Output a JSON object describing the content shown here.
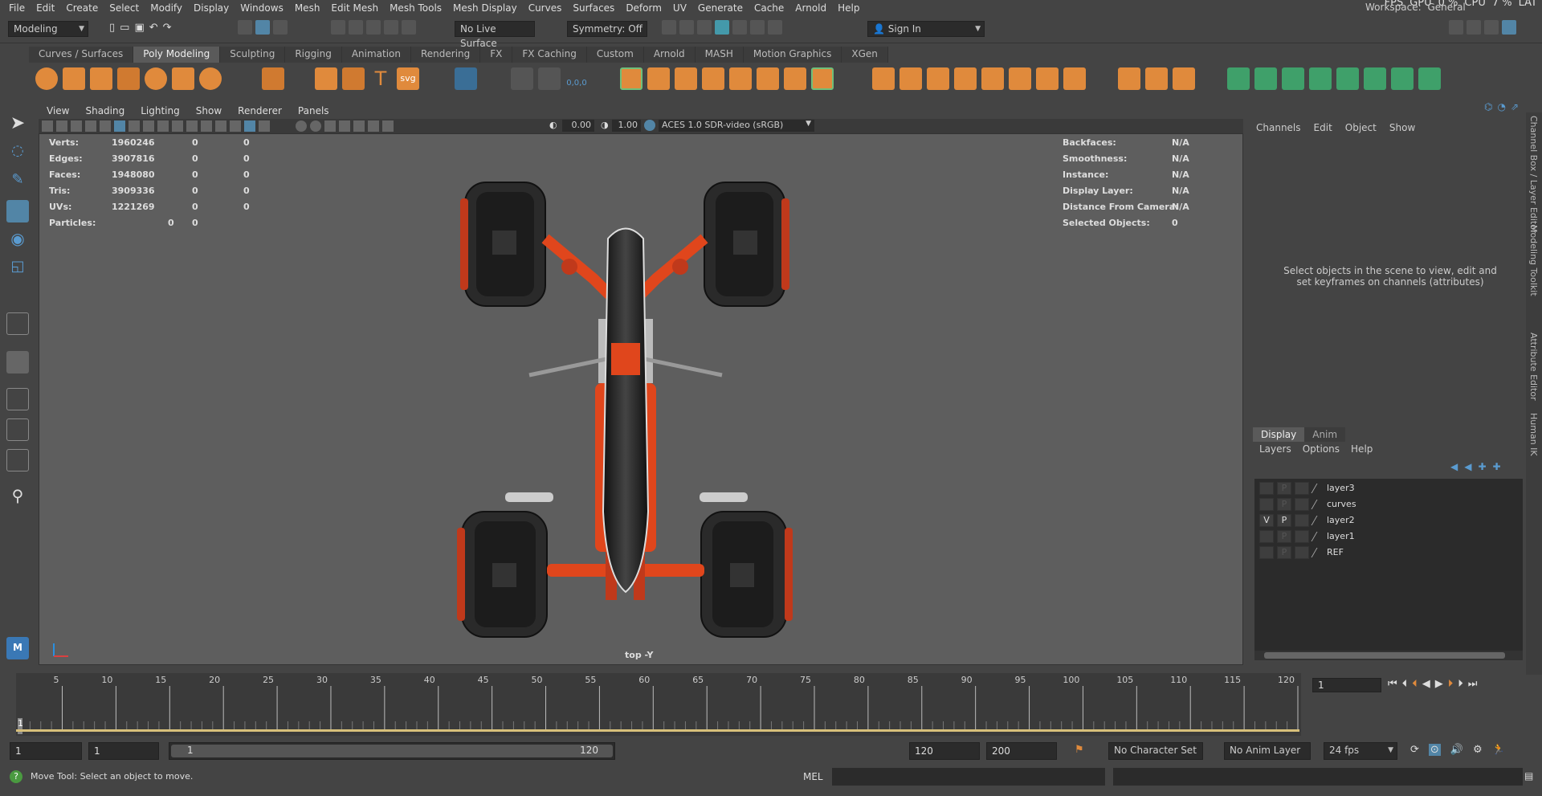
{
  "menu": [
    "File",
    "Edit",
    "Create",
    "Select",
    "Modify",
    "Display",
    "Windows",
    "Mesh",
    "Edit Mesh",
    "Mesh Tools",
    "Mesh Display",
    "Curves",
    "Surfaces",
    "Deform",
    "UV",
    "Generate",
    "Cache",
    "Arnold",
    "Help"
  ],
  "topright": {
    "fps": "FPS",
    "gpu": "GPU",
    "gpu_val": "0 %",
    "cpu": "CPU",
    "cpu_val": "7 %",
    "lat": "LAT",
    "workspace_label": "Workspace:",
    "workspace_value": "General"
  },
  "status": {
    "mode": "Modeling",
    "live_surface": "No Live Surface",
    "symmetry": "Symmetry: Off",
    "sign_in": "Sign In"
  },
  "shelf_tabs": [
    "Curves / Surfaces",
    "Poly Modeling",
    "Sculpting",
    "Rigging",
    "Animation",
    "Rendering",
    "FX",
    "FX Caching",
    "Custom",
    "Arnold",
    "MASH",
    "Motion Graphics",
    "XGen"
  ],
  "shelf_active": "Poly Modeling",
  "shelf_text_icon": "T",
  "shelf_svg_icon": "svg",
  "shelf_number_icon": "0,0,0",
  "viewport": {
    "menu": [
      "View",
      "Shading",
      "Lighting",
      "Show",
      "Renderer",
      "Panels"
    ],
    "exposure": "0.00",
    "gamma": "1.00",
    "color_space": "ACES 1.0 SDR-video (sRGB)",
    "camera_label": "top -Y",
    "hud_left": [
      {
        "label": "Verts:",
        "v1": "1960246",
        "v2": "0",
        "v3": "0"
      },
      {
        "label": "Edges:",
        "v1": "3907816",
        "v2": "0",
        "v3": "0"
      },
      {
        "label": "Faces:",
        "v1": "1948080",
        "v2": "0",
        "v3": "0"
      },
      {
        "label": "Tris:",
        "v1": "3909336",
        "v2": "0",
        "v3": "0"
      },
      {
        "label": "UVs:",
        "v1": "1221269",
        "v2": "0",
        "v3": "0"
      }
    ],
    "particles": {
      "label": "Particles:",
      "v1": "0",
      "v2": "0"
    },
    "hud_right": [
      {
        "label": "Backfaces:",
        "value": "N/A"
      },
      {
        "label": "Smoothness:",
        "value": "N/A"
      },
      {
        "label": "Instance:",
        "value": "N/A"
      },
      {
        "label": "Display Layer:",
        "value": "N/A"
      },
      {
        "label": "Distance From Camera:",
        "value": "N/A"
      },
      {
        "label": "Selected Objects:",
        "value": "0"
      }
    ]
  },
  "channel_box": {
    "menu": [
      "Channels",
      "Edit",
      "Object",
      "Show"
    ],
    "message": "Select objects in the scene to view, edit and set keyframes on channels (attributes)"
  },
  "layer_editor": {
    "tabs": [
      "Display",
      "Anim"
    ],
    "menu": [
      "Layers",
      "Options",
      "Help"
    ],
    "layers": [
      {
        "name": "layer3",
        "v": "",
        "p": "P"
      },
      {
        "name": "curves",
        "v": "",
        "p": "P"
      },
      {
        "name": "layer2",
        "v": "V",
        "p": "P"
      },
      {
        "name": "layer1",
        "v": "",
        "p": "P"
      },
      {
        "name": "REF",
        "v": "",
        "p": "P"
      }
    ]
  },
  "side_tabs": [
    "Channel Box / Layer Editor",
    "Modeling Toolkit",
    "Attribute Editor",
    "Human IK"
  ],
  "timeline": {
    "ticks": [
      "5",
      "10",
      "15",
      "20",
      "25",
      "30",
      "35",
      "40",
      "45",
      "50",
      "55",
      "60",
      "65",
      "70",
      "75",
      "80",
      "85",
      "90",
      "95",
      "100",
      "105",
      "110",
      "115",
      "120"
    ],
    "current": "1",
    "current_field": "1"
  },
  "range": {
    "start": "1",
    "anim_start": "1",
    "slider_start": "1",
    "slider_end": "120",
    "end": "120",
    "anim_end": "200",
    "character_set": "No Character Set",
    "anim_layer": "No Anim Layer",
    "fps": "24 fps"
  },
  "command": {
    "status": "Move Tool: Select an object to move.",
    "lang": "MEL"
  },
  "colors": {
    "accent": "#5285a6",
    "orange": "#e08a3c",
    "active_tab": "#5a5a5a"
  }
}
